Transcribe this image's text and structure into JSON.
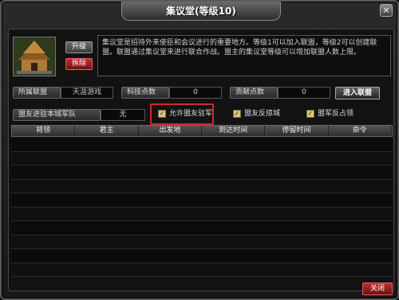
{
  "window": {
    "title": "集议堂(等级10)",
    "close_glyph": "×"
  },
  "building": {
    "upgrade_label": "升级",
    "dismantle_label": "拆除",
    "description": "集议堂是招待外来使臣和会议进行的重要地方。等级1可以加入联盟，等级2可以创建联盟。联盟通过集议堂来进行联合作战。盟主的集议堂等级可以增加联盟人数上限。"
  },
  "info": {
    "alliance_label": "所属联盟",
    "alliance_value": "天涯游戏",
    "tech_label": "科技点数",
    "tech_value": "0",
    "contrib_label": "贡献点数",
    "contrib_value": "0",
    "join_label": "进入联盟",
    "garrison_label": "盟友进驻本城军队",
    "garrison_value": "无"
  },
  "options": {
    "allow_garrison": "允许盟友驻军",
    "ally_counter": "盟友反掠城",
    "ally_occupy": "盟军反占领"
  },
  "table": {
    "headers": [
      "将领",
      "君主",
      "出发地",
      "到达时间",
      "停留时间",
      "命令"
    ],
    "rows": 10
  },
  "footer": {
    "close_label": "关闭"
  }
}
